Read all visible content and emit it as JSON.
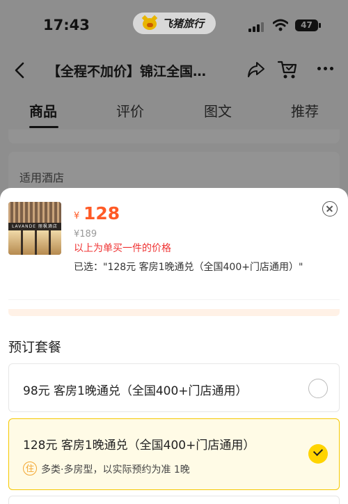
{
  "status": {
    "time": "17:43",
    "app_name": "飞猪旅行",
    "battery": "47"
  },
  "nav": {
    "title": "【全程不加价】锦江全国…"
  },
  "tabs": [
    "商品",
    "评价",
    "图文",
    "推荐"
  ],
  "background": {
    "card_label": "适用酒店"
  },
  "sheet": {
    "thumb_sign": "LAVANDE 丽枫酒店",
    "currency": "¥",
    "price": "128",
    "original_price": "¥189",
    "single_note": "以上为单买一件的价格",
    "selected": "已选：\"128元 客房1晚通兑（全国400+门店通用）\"",
    "section_title": "预订套餐",
    "options": [
      {
        "label": "98元 客房1晚通兑（全国400+门店通用）",
        "selected": false
      },
      {
        "label": "128元 客房1晚通兑（全国400+门店通用）",
        "selected": true,
        "badge": "住",
        "desc": "多类·多房型，以实际预约为准 1晚"
      }
    ]
  },
  "colors": {
    "price": "#ff5a26",
    "note": "#ef3333",
    "accent": "#ffd400"
  }
}
